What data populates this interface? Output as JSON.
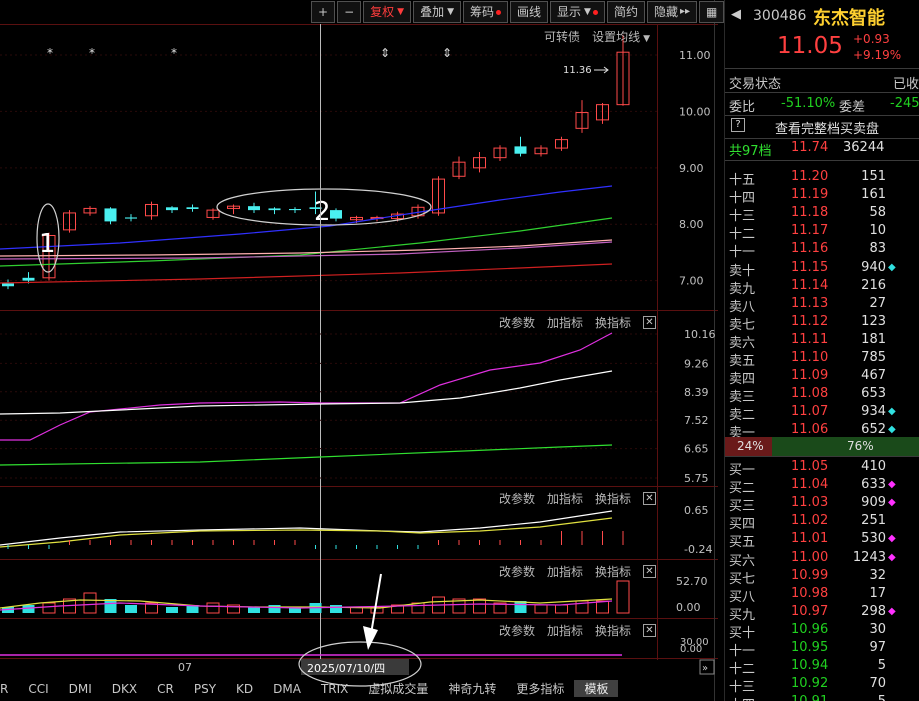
{
  "toolbar": {
    "plus": "+",
    "minus": "−",
    "fuquan": "复权",
    "diejia": "叠加",
    "chouma": "筹码",
    "huaxian": "画线",
    "xianshi": "显示",
    "jianyue": "简约",
    "yincang": "隐藏",
    "expand": "▸▸",
    "grid": "▦"
  },
  "main_panel": {
    "convertible": "可转债",
    "ma_setting": "设置均线",
    "high_label": "11.36",
    "annot_1": "1",
    "annot_2": "2",
    "y_ticks": [
      "11.00",
      "10.00",
      "9.00",
      "8.00",
      "7.00"
    ],
    "markers": [
      "*",
      "*",
      "*",
      "⇕",
      "⇕"
    ]
  },
  "sub_panel_1": {
    "change_param": "改参数",
    "add_indicator": "加指标",
    "switch_indicator": "换指标",
    "y_ticks": [
      "10.16",
      "9.26",
      "8.39",
      "7.52",
      "6.65",
      "5.75"
    ]
  },
  "sub_panel_2": {
    "change_param": "改参数",
    "add_indicator": "加指标",
    "switch_indicator": "换指标",
    "y_ticks": [
      "0.65",
      "-0.24"
    ]
  },
  "sub_panel_3": {
    "change_param": "改参数",
    "add_indicator": "加指标",
    "switch_indicator": "换指标",
    "y_ticks": [
      "52.70",
      "0.00"
    ]
  },
  "sub_panel_4": {
    "change_param": "改参数",
    "add_indicator": "加指标",
    "switch_indicator": "换指标",
    "y_ticks": [
      "30.00",
      "0.00"
    ]
  },
  "x_axis": {
    "month_label": "07",
    "cursor_date": "2025/07/10/四"
  },
  "bottom_tabs": [
    "R",
    "CCI",
    "DMI",
    "DKX",
    "CR",
    "PSY",
    "KD",
    "DMA",
    "TRIX",
    "虚拟成交量",
    "神奇九转",
    "更多指标",
    "模板"
  ],
  "quote": {
    "code": "300486",
    "name": "东杰智能",
    "price": "11.05",
    "change": "+0.93",
    "change_pct": "+9.19%",
    "status_label": "交易状态",
    "status_value": "已收",
    "weibi_label": "委比",
    "weibi_value": "-51.10%",
    "weicha_label": "委差",
    "weicha_value": "-245",
    "full_book": "查看完整档买卖盘",
    "levels_label": "共97档",
    "levels_price": "11.74",
    "levels_vol": "36244",
    "asks": [
      {
        "label": "十五",
        "price": "11.20",
        "vol": "151",
        "mark": ""
      },
      {
        "label": "十四",
        "price": "11.19",
        "vol": "161",
        "mark": ""
      },
      {
        "label": "十三",
        "price": "11.18",
        "vol": "58",
        "mark": ""
      },
      {
        "label": "十二",
        "price": "11.17",
        "vol": "10",
        "mark": ""
      },
      {
        "label": "十一",
        "price": "11.16",
        "vol": "83",
        "mark": ""
      },
      {
        "label": "卖十",
        "price": "11.15",
        "vol": "940",
        "mark": "◆"
      },
      {
        "label": "卖九",
        "price": "11.14",
        "vol": "216",
        "mark": ""
      },
      {
        "label": "卖八",
        "price": "11.13",
        "vol": "27",
        "mark": ""
      },
      {
        "label": "卖七",
        "price": "11.12",
        "vol": "123",
        "mark": ""
      },
      {
        "label": "卖六",
        "price": "11.11",
        "vol": "181",
        "mark": ""
      },
      {
        "label": "卖五",
        "price": "11.10",
        "vol": "785",
        "mark": ""
      },
      {
        "label": "卖四",
        "price": "11.09",
        "vol": "467",
        "mark": ""
      },
      {
        "label": "卖三",
        "price": "11.08",
        "vol": "653",
        "mark": ""
      },
      {
        "label": "卖二",
        "price": "11.07",
        "vol": "934",
        "mark": "◆"
      },
      {
        "label": "卖一",
        "price": "11.06",
        "vol": "652",
        "mark": "◆"
      }
    ],
    "ratio_left": "24%",
    "ratio_right": "76%",
    "bids": [
      {
        "label": "买一",
        "price": "11.05",
        "vol": "410",
        "mark": ""
      },
      {
        "label": "买二",
        "price": "11.04",
        "vol": "633",
        "mark": "◆"
      },
      {
        "label": "买三",
        "price": "11.03",
        "vol": "909",
        "mark": "◆"
      },
      {
        "label": "买四",
        "price": "11.02",
        "vol": "251",
        "mark": ""
      },
      {
        "label": "买五",
        "price": "11.01",
        "vol": "530",
        "mark": "◆"
      },
      {
        "label": "买六",
        "price": "11.00",
        "vol": "1243",
        "mark": "◆"
      },
      {
        "label": "买七",
        "price": "10.99",
        "vol": "32",
        "mark": ""
      },
      {
        "label": "买八",
        "price": "10.98",
        "vol": "17",
        "mark": ""
      },
      {
        "label": "买九",
        "price": "10.97",
        "vol": "298",
        "mark": "◆"
      },
      {
        "label": "买十",
        "price": "10.96",
        "vol": "30",
        "mark": ""
      },
      {
        "label": "十一",
        "price": "10.95",
        "vol": "97",
        "mark": ""
      },
      {
        "label": "十二",
        "price": "10.94",
        "vol": "5",
        "mark": ""
      },
      {
        "label": "十三",
        "price": "10.92",
        "vol": "70",
        "mark": ""
      },
      {
        "label": "十四",
        "price": "10.91",
        "vol": "5",
        "mark": ""
      }
    ]
  },
  "chart_data": {
    "type": "candlestick",
    "price_range": [
      6.55,
      11.55
    ],
    "candles": [
      {
        "o": 6.95,
        "h": 7.02,
        "c": 6.9,
        "l": 6.85
      },
      {
        "o": 7.05,
        "h": 7.15,
        "c": 7.0,
        "l": 6.95
      },
      {
        "o": 7.05,
        "h": 7.85,
        "c": 7.8,
        "l": 7.0
      },
      {
        "o": 7.9,
        "h": 8.25,
        "c": 8.2,
        "l": 7.85
      },
      {
        "o": 8.2,
        "h": 8.32,
        "c": 8.28,
        "l": 8.15
      },
      {
        "o": 8.28,
        "h": 8.3,
        "c": 8.05,
        "l": 8.0
      },
      {
        "o": 8.12,
        "h": 8.18,
        "c": 8.1,
        "l": 8.05
      },
      {
        "o": 8.15,
        "h": 8.4,
        "c": 8.35,
        "l": 8.08
      },
      {
        "o": 8.3,
        "h": 8.32,
        "c": 8.25,
        "l": 8.2
      },
      {
        "o": 8.3,
        "h": 8.35,
        "c": 8.27,
        "l": 8.22
      },
      {
        "o": 8.12,
        "h": 8.28,
        "c": 8.25,
        "l": 8.08
      },
      {
        "o": 8.28,
        "h": 8.35,
        "c": 8.32,
        "l": 8.18
      },
      {
        "o": 8.32,
        "h": 8.38,
        "c": 8.25,
        "l": 8.2
      },
      {
        "o": 8.28,
        "h": 8.3,
        "c": 8.25,
        "l": 8.18
      },
      {
        "o": 8.27,
        "h": 8.3,
        "c": 8.25,
        "l": 8.2
      },
      {
        "o": 8.3,
        "h": 8.58,
        "c": 8.27,
        "l": 8.18
      },
      {
        "o": 8.25,
        "h": 8.28,
        "c": 8.1,
        "l": 8.05
      },
      {
        "o": 8.08,
        "h": 8.15,
        "c": 8.12,
        "l": 8.02
      },
      {
        "o": 8.1,
        "h": 8.15,
        "c": 8.12,
        "l": 8.05
      },
      {
        "o": 8.1,
        "h": 8.22,
        "c": 8.18,
        "l": 8.05
      },
      {
        "o": 8.15,
        "h": 8.35,
        "c": 8.3,
        "l": 8.1
      },
      {
        "o": 8.2,
        "h": 8.85,
        "c": 8.8,
        "l": 8.15
      },
      {
        "o": 8.85,
        "h": 9.2,
        "c": 9.1,
        "l": 8.8
      },
      {
        "o": 9.0,
        "h": 9.28,
        "c": 9.18,
        "l": 8.92
      },
      {
        "o": 9.18,
        "h": 9.4,
        "c": 9.35,
        "l": 9.12
      },
      {
        "o": 9.38,
        "h": 9.55,
        "c": 9.25,
        "l": 9.2
      },
      {
        "o": 9.25,
        "h": 9.4,
        "c": 9.35,
        "l": 9.2
      },
      {
        "o": 9.35,
        "h": 9.55,
        "c": 9.5,
        "l": 9.3
      },
      {
        "o": 9.7,
        "h": 10.2,
        "c": 9.98,
        "l": 9.62
      },
      {
        "o": 9.85,
        "h": 10.15,
        "c": 10.12,
        "l": 9.78
      },
      {
        "o": 10.12,
        "h": 11.36,
        "c": 11.05,
        "l": 10.1
      }
    ]
  }
}
